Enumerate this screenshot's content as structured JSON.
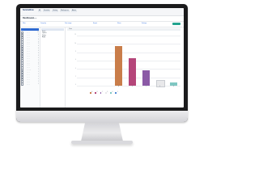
{
  "app": {
    "logo": "ServiceNow",
    "nav": [
      "All",
      "Favorites",
      "History",
      "Workspaces",
      "Admin"
    ],
    "title": "Dashboard",
    "subtitle": "Reports"
  },
  "filters": [
    "Filter",
    "Group by",
    "Date range",
    "Export",
    "Share",
    "Settings"
  ],
  "sidebar": {
    "items": [
      {
        "label": "Category A",
        "count": "12"
      },
      {
        "label": "Category B",
        "count": "9"
      },
      {
        "label": "Category C",
        "count": "7"
      },
      {
        "label": "Category D",
        "count": "6"
      },
      {
        "label": "Category E",
        "count": "5"
      },
      {
        "label": "Category F",
        "count": "5"
      },
      {
        "label": "Category G",
        "count": "4"
      },
      {
        "label": "Category H",
        "count": "4"
      },
      {
        "label": "Category I",
        "count": "3"
      },
      {
        "label": "Category J",
        "count": "3"
      },
      {
        "label": "Category K",
        "count": "3"
      },
      {
        "label": "Category L",
        "count": "2"
      },
      {
        "label": "Category M",
        "count": "2"
      },
      {
        "label": "Category N",
        "count": "2"
      },
      {
        "label": "Category O",
        "count": "2"
      },
      {
        "label": "Category P",
        "count": "1"
      },
      {
        "label": "Category Q",
        "count": "1"
      },
      {
        "label": "Category R",
        "count": "1"
      },
      {
        "label": "Category S",
        "count": "1"
      },
      {
        "label": "Category T",
        "count": "1"
      },
      {
        "label": "Category U",
        "count": "1"
      },
      {
        "label": "Category V",
        "count": "1"
      },
      {
        "label": "Category W",
        "count": "1"
      }
    ]
  },
  "column2": [
    "Select",
    "Options",
    "Values",
    "Apply"
  ],
  "panel": {
    "header": "Chart"
  },
  "chart_data": {
    "type": "bar",
    "title": "",
    "categories": [
      "A",
      "B",
      "C",
      "D",
      "E",
      "F"
    ],
    "values": [
      9.5,
      6.5,
      3.6,
      1.4,
      0.7,
      0.6
    ],
    "colors": [
      "#c97d4a",
      "#b5467a",
      "#8b5aa6",
      "#e8e8ea",
      "#7fc7c2",
      "#4d86d6"
    ],
    "ylim": [
      0,
      12
    ],
    "yticks": [
      0,
      2,
      4,
      6,
      8,
      10,
      12
    ],
    "legend": [
      "A",
      "B",
      "C",
      "D",
      "E",
      "F"
    ],
    "grid": true
  }
}
